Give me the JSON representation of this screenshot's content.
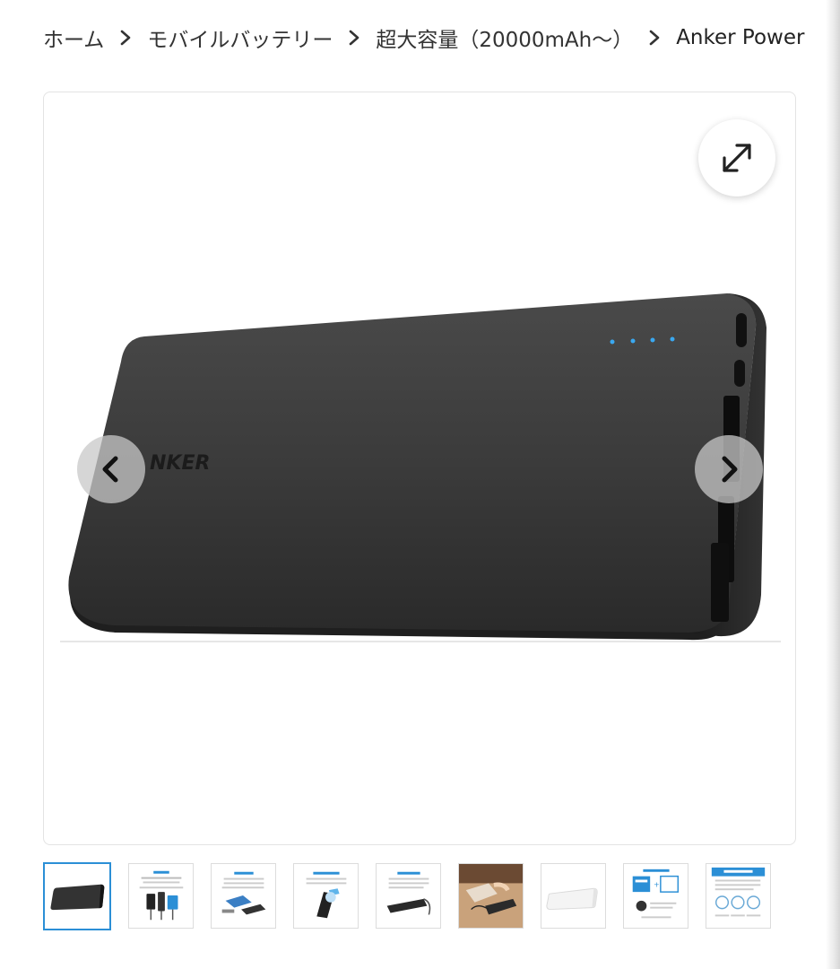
{
  "breadcrumb": {
    "items": [
      {
        "label": "ホーム"
      },
      {
        "label": "モバイルバッテリー"
      },
      {
        "label": "超大容量（20000mAh〜）"
      },
      {
        "label": "Anker Power"
      }
    ]
  },
  "gallery": {
    "product_logo_text": "NKER",
    "expand_icon": "expand-arrows-icon",
    "prev_icon": "chevron-left-icon",
    "next_icon": "chevron-right-icon",
    "active_thumbnail": 1,
    "thumbnail_count": 9
  },
  "colors": {
    "thumb_active_border": "#2b8fd6",
    "led": "#3aa8f0",
    "product_body": "#3a3a3a"
  }
}
